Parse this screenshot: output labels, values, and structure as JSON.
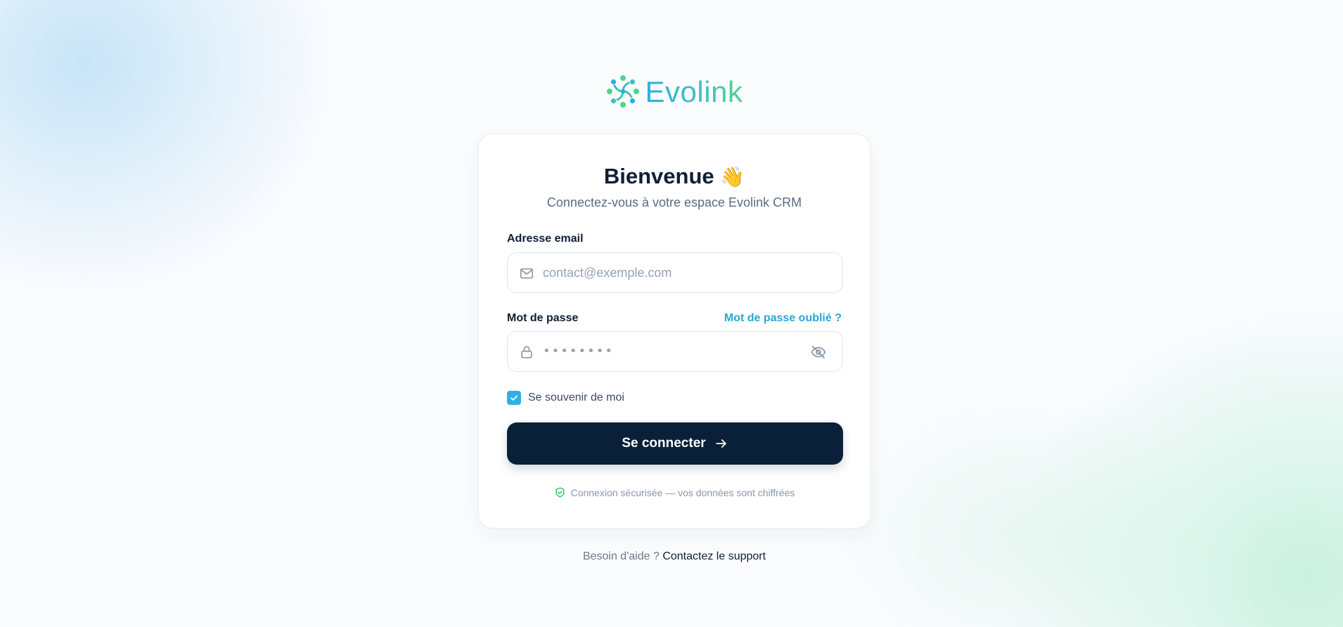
{
  "brand": {
    "name": "Evolink",
    "colors": {
      "gradient_start": "#2ab0e0",
      "gradient_end": "#4fd58c"
    }
  },
  "card": {
    "title": "Bienvenue",
    "title_emoji": "👋",
    "subtitle": "Connectez-vous à votre espace Evolink CRM"
  },
  "email": {
    "label": "Adresse email",
    "placeholder": "contact@exemple.com",
    "value": "",
    "icon": "mail-icon"
  },
  "password": {
    "label": "Mot de passe",
    "forgot_link": "Mot de passe oublié ?",
    "masked_placeholder": "••••••••",
    "icon": "lock-icon",
    "toggle_icon": "eye-off-icon"
  },
  "remember": {
    "label": "Se souvenir de moi",
    "checked": true
  },
  "submit": {
    "label": "Se connecter",
    "icon": "arrow-right-icon",
    "color": "#0a1f38"
  },
  "security_note": {
    "text": "Connexion sécurisée — vos données sont chiffrées",
    "icon": "shield-check-icon",
    "icon_color": "#22c55e"
  },
  "footer": {
    "prompt": "Besoin d'aide ?",
    "link": "Contactez le support"
  }
}
